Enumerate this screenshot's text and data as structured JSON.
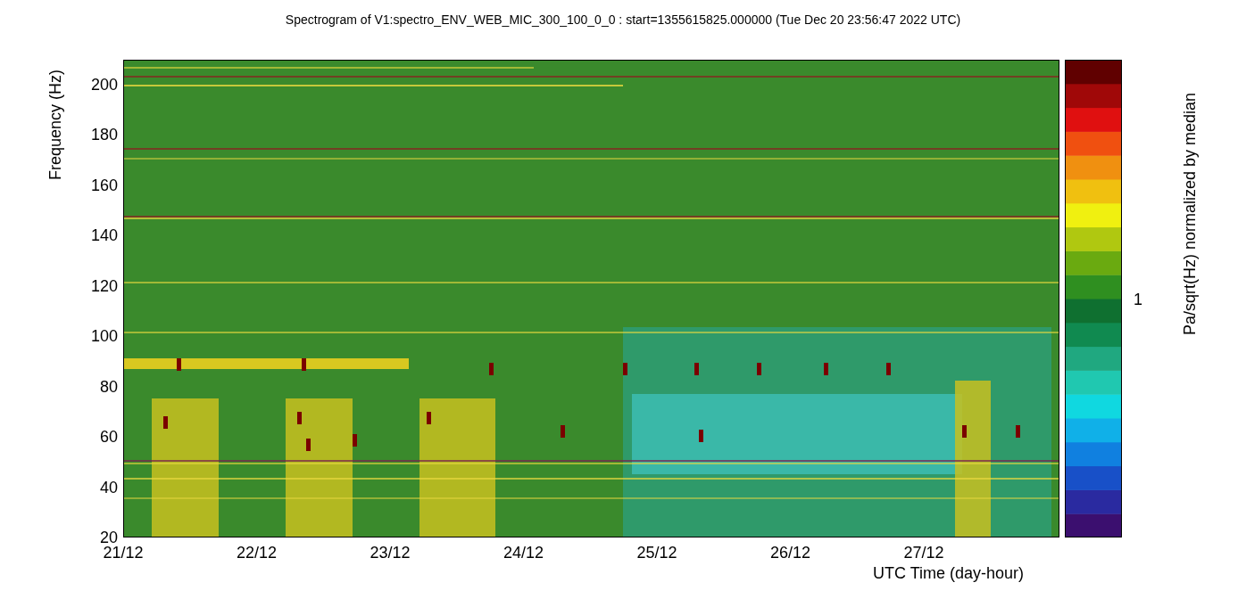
{
  "title": "Spectrogram of V1:spectro_ENV_WEB_MIC_300_100_0_0 : start=1355615825.000000 (Tue Dec 20 23:56:47 2022 UTC)",
  "y_axis": {
    "label": "Frequency (Hz)",
    "ticks": [
      "200",
      "180",
      "160",
      "140",
      "120",
      "100",
      "80",
      "60",
      "40",
      "20"
    ]
  },
  "x_axis": {
    "label": "UTC Time (day-hour)",
    "ticks": [
      "21/12",
      "22/12",
      "23/12",
      "24/12",
      "25/12",
      "26/12",
      "27/12"
    ]
  },
  "colorbar": {
    "label": "Pa/sqrt(Hz) normalized by median",
    "tick": "1"
  }
}
